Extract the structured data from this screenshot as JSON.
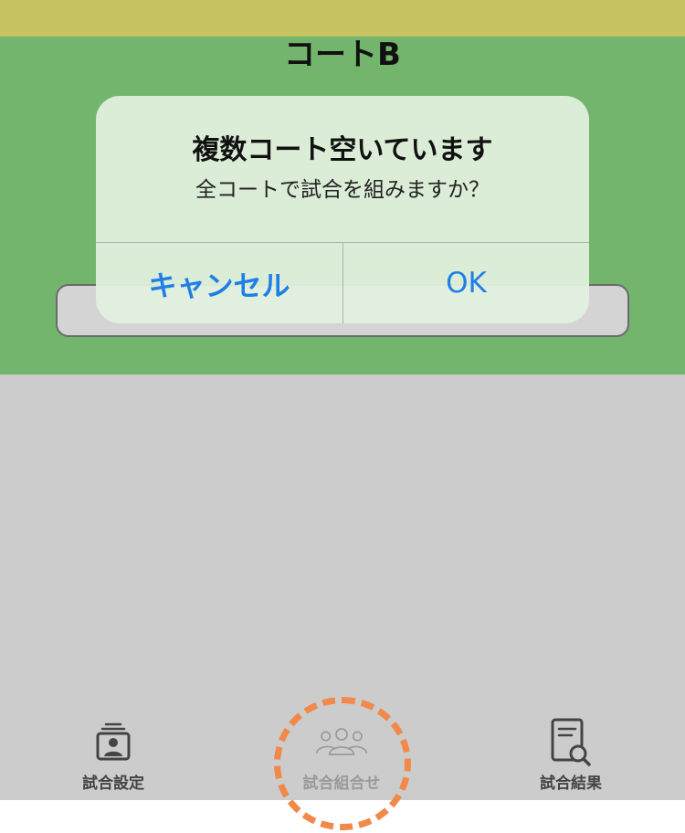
{
  "court": {
    "title": "コートB"
  },
  "dialog": {
    "title": "複数コート空いています",
    "message": "全コートで試合を組みますか？",
    "cancel_label": "キャンセル",
    "ok_label": "OK"
  },
  "tabs": [
    {
      "label": "試合設定",
      "icon": "person-card-stack-icon",
      "color": "#444444"
    },
    {
      "label": "試合組合せ",
      "icon": "group-people-icon",
      "color": "#9a9a9a"
    },
    {
      "label": "試合結果",
      "icon": "document-search-icon",
      "color": "#444444"
    }
  ],
  "colors": {
    "top_bar": "#c7c361",
    "court_panel": "#73b56c",
    "content_background": "#cccccc",
    "dialog_button": "#1f7fe6",
    "highlight_ring": "#f0894a"
  }
}
